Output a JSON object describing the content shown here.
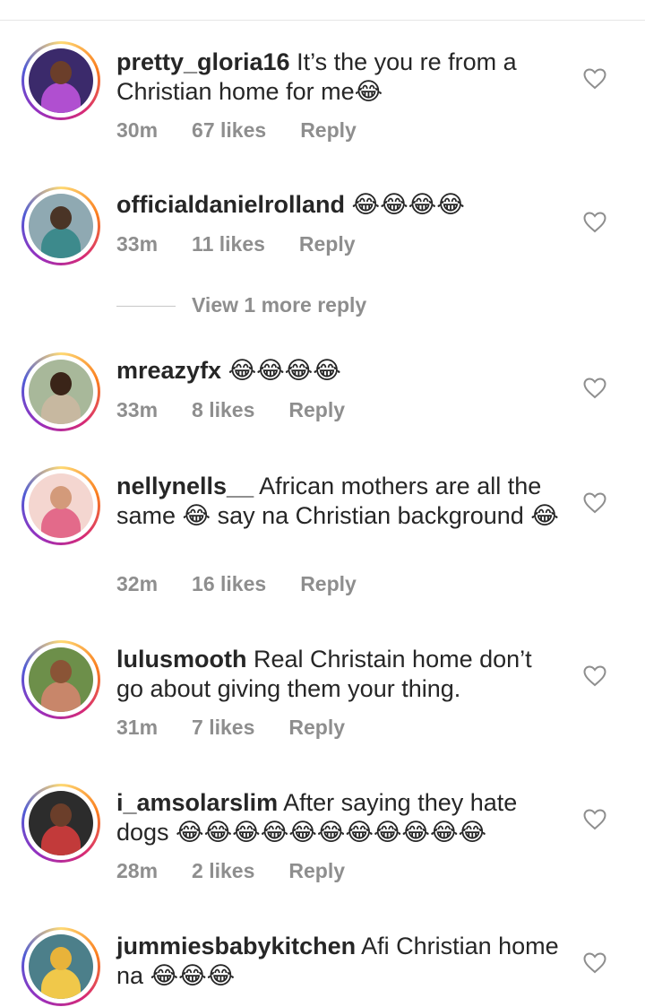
{
  "comments": [
    {
      "username": "pretty_gloria16",
      "text": " It’s the you re from a Christian home for me😂",
      "time": "30m",
      "likes": "67 likes",
      "reply": "Reply",
      "avatar": {
        "bg": "#3b2a6b",
        "skin": "#6b3e2a",
        "cloth": "#b04fd0"
      }
    },
    {
      "username": "officialdanielrolland",
      "text": " 😂😂😂😂",
      "time": "33m",
      "likes": "11 likes",
      "reply": "Reply",
      "avatar": {
        "bg": "#8fa9b2",
        "skin": "#4a3426",
        "cloth": "#3d8a8c"
      }
    },
    {
      "username": "mreazyfx",
      "text": " 😂😂😂😂",
      "time": "33m",
      "likes": "8 likes",
      "reply": "Reply",
      "avatar": {
        "bg": "#a8b89a",
        "skin": "#3a2418",
        "cloth": "#c7b8a0"
      }
    },
    {
      "username": "nellynells__",
      "text": " African mothers are all the same 😂 say na Christian background 😂",
      "time": "32m",
      "likes": "16 likes",
      "reply": "Reply",
      "avatar": {
        "bg": "#f4d6d0",
        "skin": "#d39a7a",
        "cloth": "#e36a8a"
      }
    },
    {
      "username": "lulusmooth",
      "text": " Real Christain home don’t go about giving them your thing.",
      "time": "31m",
      "likes": "7 likes",
      "reply": "Reply",
      "avatar": {
        "bg": "#6d8f4a",
        "skin": "#8a5436",
        "cloth": "#c8866a"
      }
    },
    {
      "username": "i_amsolarslim",
      "text": " After saying they hate dogs 😂😂😂😂😂😂😂😂😂😂😂",
      "time": "28m",
      "likes": "2 likes",
      "reply": "Reply",
      "avatar": {
        "bg": "#2c2c2c",
        "skin": "#6b3e2a",
        "cloth": "#c23a3a"
      }
    },
    {
      "username": "jummiesbabykitchen",
      "text": " Afi Christian home na 😂😂😂",
      "time": "",
      "likes": "",
      "reply": "",
      "avatar": {
        "bg": "#4c7f8a",
        "skin": "#e8b33a",
        "cloth": "#f0c84a"
      }
    }
  ],
  "view_more_reply": "View 1 more reply",
  "colors": {
    "heart_stroke": "#8e8e8e",
    "meta_text": "#8e8e8e"
  }
}
